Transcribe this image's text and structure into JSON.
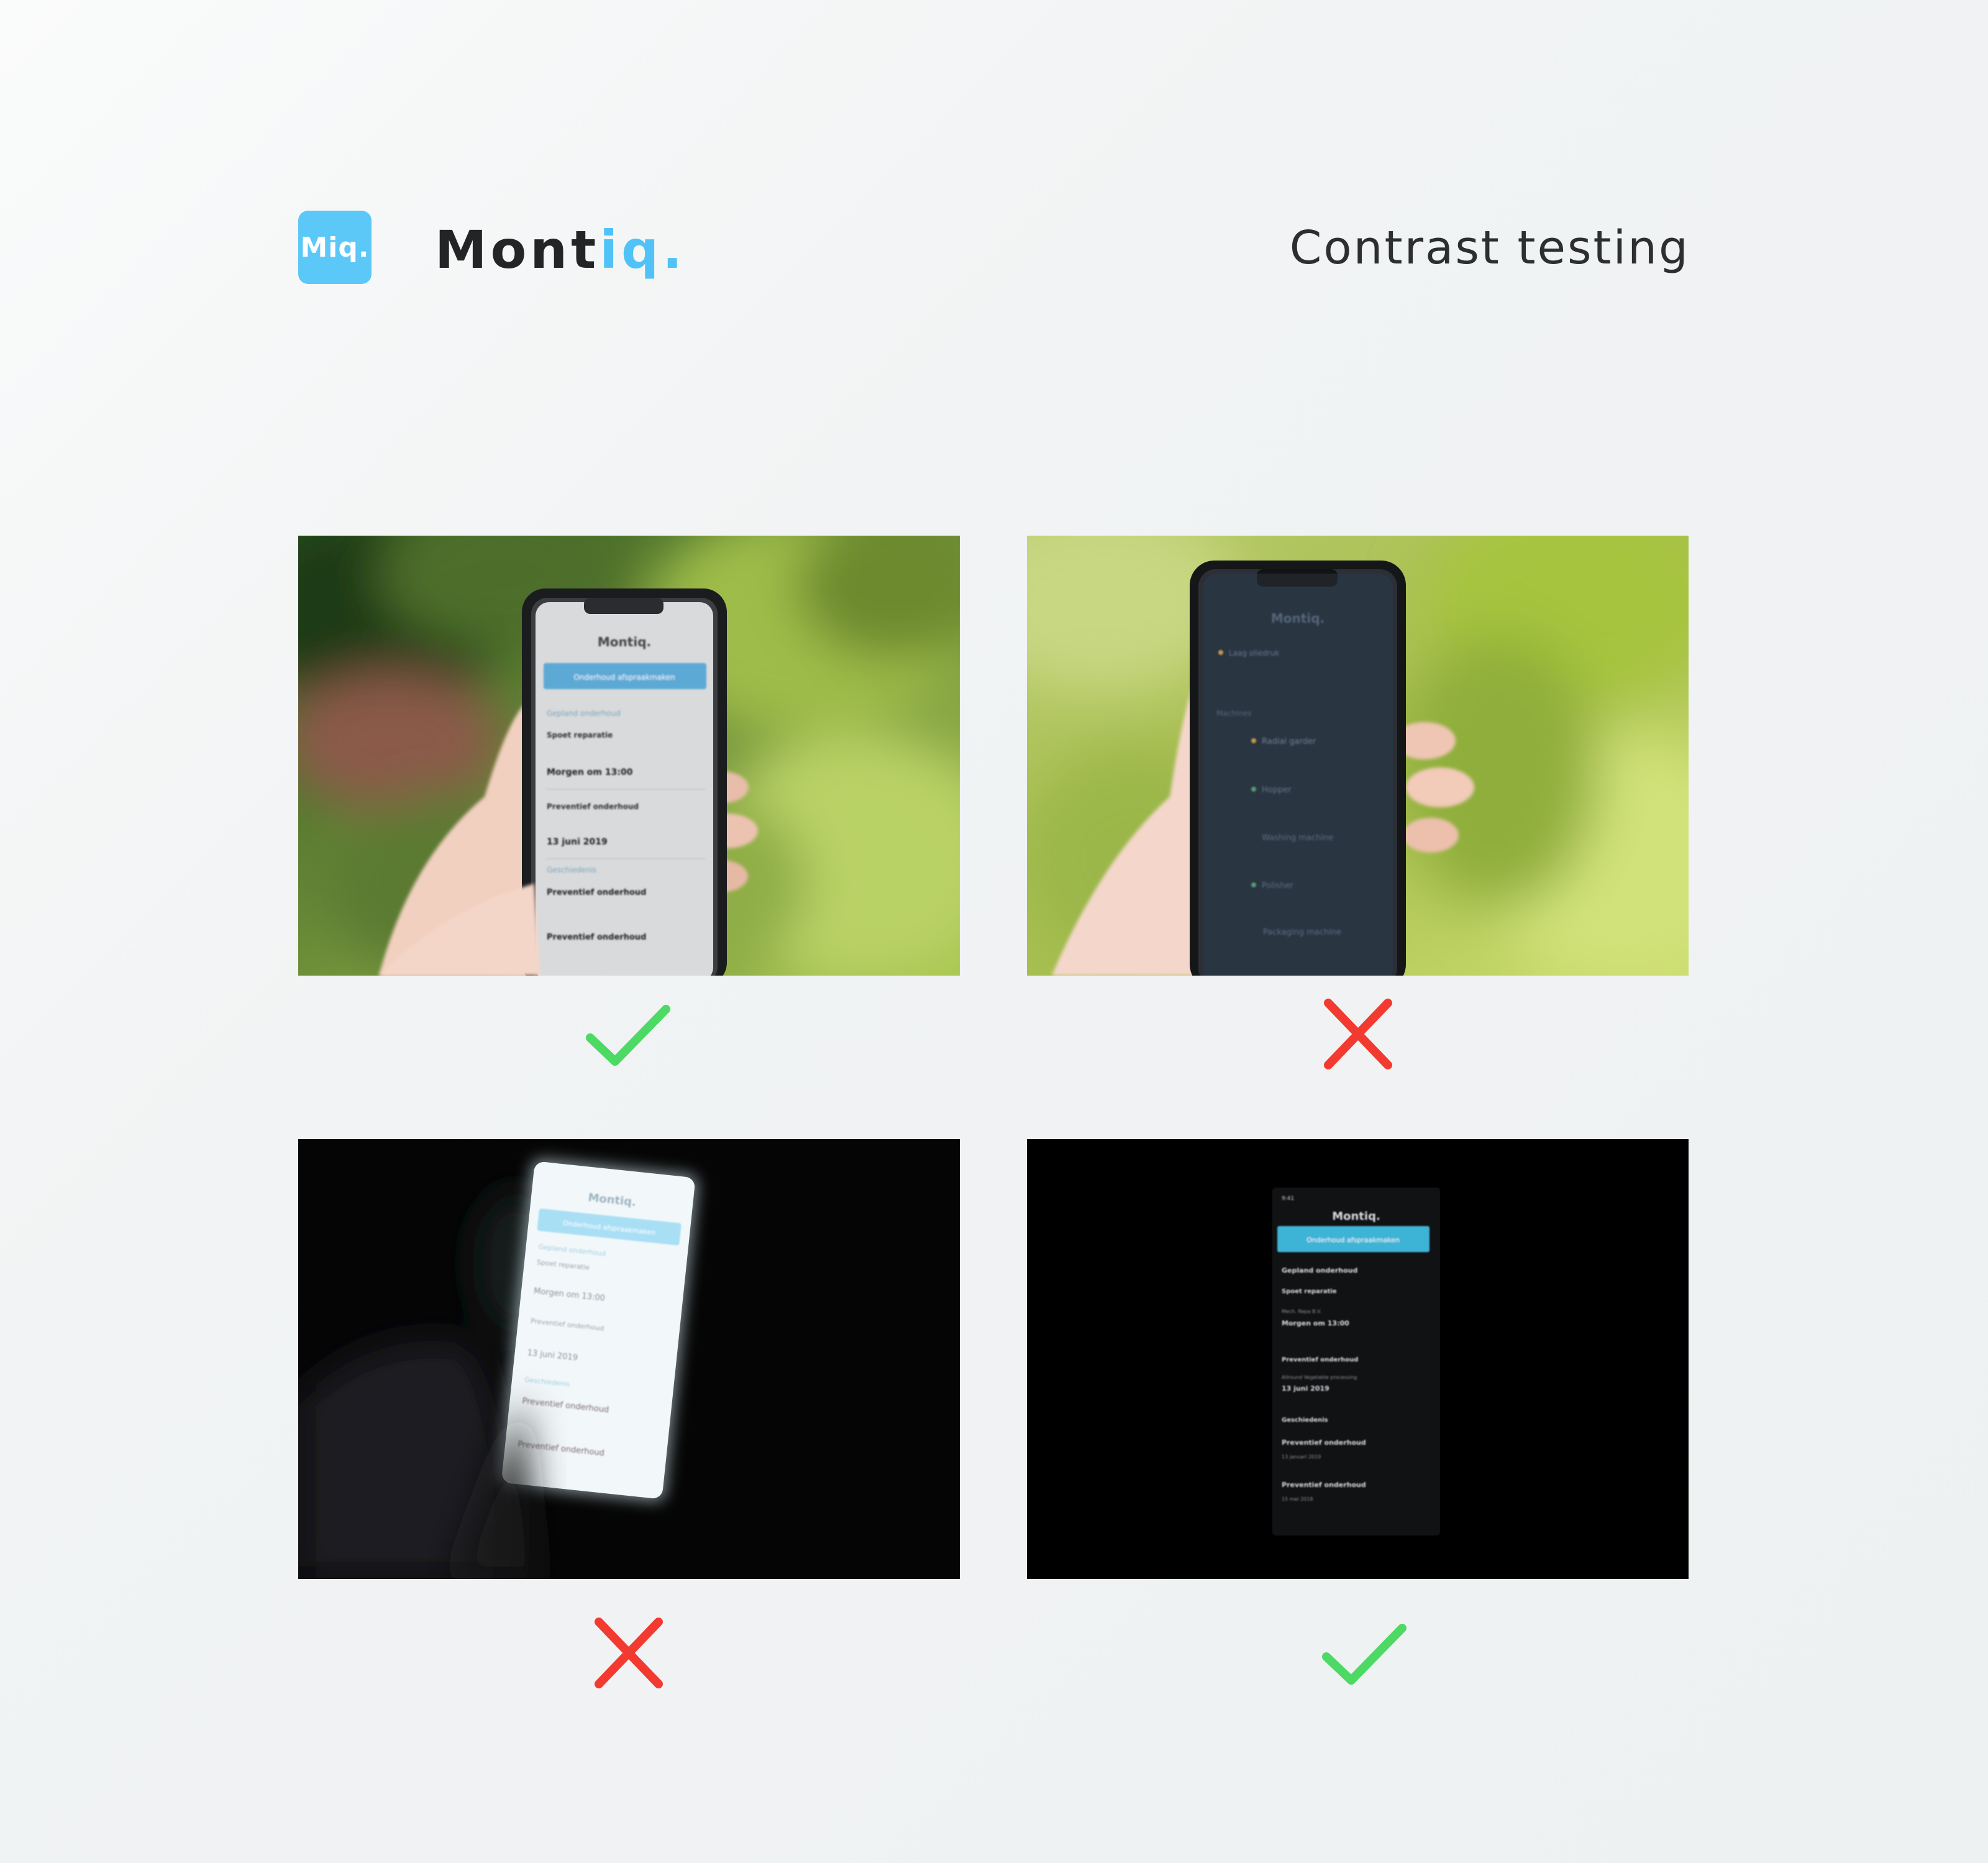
{
  "header": {
    "app_icon_text": "Miq.",
    "logo_main": "Mont",
    "logo_accent": "iq.",
    "title": "Contrast testing"
  },
  "colors": {
    "brand_blue": "#5bc8f8",
    "pass_green": "#4cd964",
    "fail_red": "#f23a30"
  },
  "photos": [
    {
      "verdict": "pass",
      "verdict_icon": "checkmark-icon",
      "theme": "light-ui-daylight",
      "screen": {
        "logo": "Montiq.",
        "button": "Onderhoud afspraakmaken",
        "rows": [
          "Gepland onderhoud",
          "Spoet reparatie",
          "Morgen om 13:00",
          "Preventief onderhoud",
          "13 juni 2019",
          "Geschiedenis",
          "Preventief onderhoud",
          "Preventief onderhoud"
        ]
      }
    },
    {
      "verdict": "fail",
      "verdict_icon": "cross-icon",
      "theme": "dark-ui-daylight",
      "screen": {
        "logo": "Montiq.",
        "rows": [
          "Laag oliedruk",
          "Machines",
          "Radial garder",
          "Hopper",
          "Washing machine",
          "Polisher",
          "Packaging machine"
        ]
      }
    },
    {
      "verdict": "fail",
      "verdict_icon": "cross-icon",
      "theme": "light-ui-dark",
      "screen": {
        "logo": "Montiq.",
        "button": "Onderhoud afspraakmaken",
        "rows": [
          "Gepland onderhoud",
          "Spoet reparatie",
          "Morgen om 13:00",
          "Preventief onderhoud",
          "13 juni 2019",
          "Geschiedenis",
          "Preventief onderhoud",
          "Preventief onderhoud"
        ]
      }
    },
    {
      "verdict": "pass",
      "verdict_icon": "checkmark-icon",
      "theme": "dark-ui-dark",
      "screen": {
        "time": "9:41",
        "logo": "Montiq.",
        "button": "Onderhoud afspraakmaken",
        "rows": [
          "Gepland onderhoud",
          "Spoet reparatie",
          "Mech. Repa B.V.",
          "Morgen om 13:00",
          "Preventief onderhoud",
          "Allround Vegetable processing",
          "13 juni 2019",
          "Geschiedenis",
          "Preventief onderhoud",
          "13 januari 2019",
          "Preventief onderhoud",
          "15 mei 2018"
        ]
      }
    }
  ]
}
